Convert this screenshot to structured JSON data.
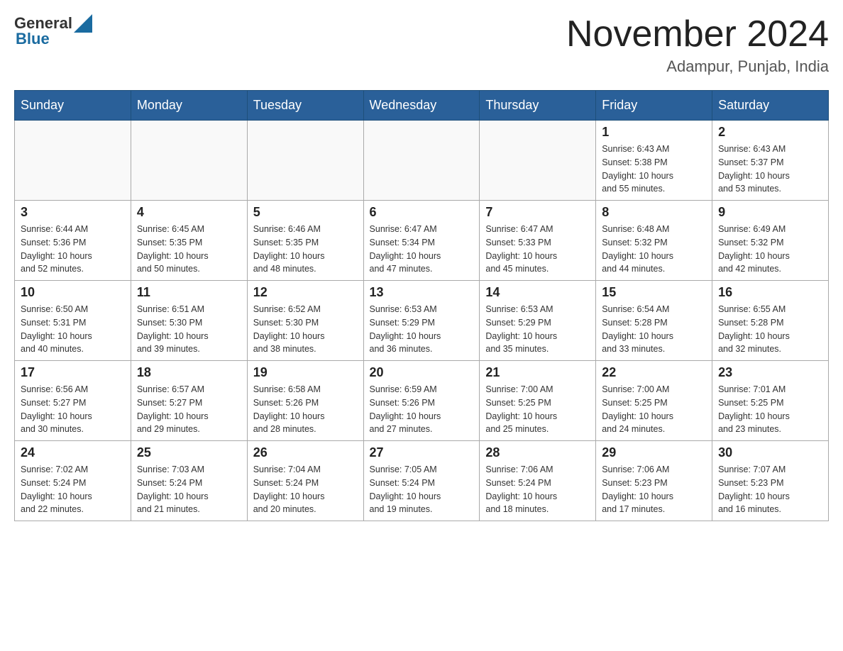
{
  "header": {
    "logo_general": "General",
    "logo_blue": "Blue",
    "title": "November 2024",
    "location": "Adampur, Punjab, India"
  },
  "days_of_week": [
    "Sunday",
    "Monday",
    "Tuesday",
    "Wednesday",
    "Thursday",
    "Friday",
    "Saturday"
  ],
  "weeks": [
    [
      {
        "day": "",
        "info": ""
      },
      {
        "day": "",
        "info": ""
      },
      {
        "day": "",
        "info": ""
      },
      {
        "day": "",
        "info": ""
      },
      {
        "day": "",
        "info": ""
      },
      {
        "day": "1",
        "info": "Sunrise: 6:43 AM\nSunset: 5:38 PM\nDaylight: 10 hours\nand 55 minutes."
      },
      {
        "day": "2",
        "info": "Sunrise: 6:43 AM\nSunset: 5:37 PM\nDaylight: 10 hours\nand 53 minutes."
      }
    ],
    [
      {
        "day": "3",
        "info": "Sunrise: 6:44 AM\nSunset: 5:36 PM\nDaylight: 10 hours\nand 52 minutes."
      },
      {
        "day": "4",
        "info": "Sunrise: 6:45 AM\nSunset: 5:35 PM\nDaylight: 10 hours\nand 50 minutes."
      },
      {
        "day": "5",
        "info": "Sunrise: 6:46 AM\nSunset: 5:35 PM\nDaylight: 10 hours\nand 48 minutes."
      },
      {
        "day": "6",
        "info": "Sunrise: 6:47 AM\nSunset: 5:34 PM\nDaylight: 10 hours\nand 47 minutes."
      },
      {
        "day": "7",
        "info": "Sunrise: 6:47 AM\nSunset: 5:33 PM\nDaylight: 10 hours\nand 45 minutes."
      },
      {
        "day": "8",
        "info": "Sunrise: 6:48 AM\nSunset: 5:32 PM\nDaylight: 10 hours\nand 44 minutes."
      },
      {
        "day": "9",
        "info": "Sunrise: 6:49 AM\nSunset: 5:32 PM\nDaylight: 10 hours\nand 42 minutes."
      }
    ],
    [
      {
        "day": "10",
        "info": "Sunrise: 6:50 AM\nSunset: 5:31 PM\nDaylight: 10 hours\nand 40 minutes."
      },
      {
        "day": "11",
        "info": "Sunrise: 6:51 AM\nSunset: 5:30 PM\nDaylight: 10 hours\nand 39 minutes."
      },
      {
        "day": "12",
        "info": "Sunrise: 6:52 AM\nSunset: 5:30 PM\nDaylight: 10 hours\nand 38 minutes."
      },
      {
        "day": "13",
        "info": "Sunrise: 6:53 AM\nSunset: 5:29 PM\nDaylight: 10 hours\nand 36 minutes."
      },
      {
        "day": "14",
        "info": "Sunrise: 6:53 AM\nSunset: 5:29 PM\nDaylight: 10 hours\nand 35 minutes."
      },
      {
        "day": "15",
        "info": "Sunrise: 6:54 AM\nSunset: 5:28 PM\nDaylight: 10 hours\nand 33 minutes."
      },
      {
        "day": "16",
        "info": "Sunrise: 6:55 AM\nSunset: 5:28 PM\nDaylight: 10 hours\nand 32 minutes."
      }
    ],
    [
      {
        "day": "17",
        "info": "Sunrise: 6:56 AM\nSunset: 5:27 PM\nDaylight: 10 hours\nand 30 minutes."
      },
      {
        "day": "18",
        "info": "Sunrise: 6:57 AM\nSunset: 5:27 PM\nDaylight: 10 hours\nand 29 minutes."
      },
      {
        "day": "19",
        "info": "Sunrise: 6:58 AM\nSunset: 5:26 PM\nDaylight: 10 hours\nand 28 minutes."
      },
      {
        "day": "20",
        "info": "Sunrise: 6:59 AM\nSunset: 5:26 PM\nDaylight: 10 hours\nand 27 minutes."
      },
      {
        "day": "21",
        "info": "Sunrise: 7:00 AM\nSunset: 5:25 PM\nDaylight: 10 hours\nand 25 minutes."
      },
      {
        "day": "22",
        "info": "Sunrise: 7:00 AM\nSunset: 5:25 PM\nDaylight: 10 hours\nand 24 minutes."
      },
      {
        "day": "23",
        "info": "Sunrise: 7:01 AM\nSunset: 5:25 PM\nDaylight: 10 hours\nand 23 minutes."
      }
    ],
    [
      {
        "day": "24",
        "info": "Sunrise: 7:02 AM\nSunset: 5:24 PM\nDaylight: 10 hours\nand 22 minutes."
      },
      {
        "day": "25",
        "info": "Sunrise: 7:03 AM\nSunset: 5:24 PM\nDaylight: 10 hours\nand 21 minutes."
      },
      {
        "day": "26",
        "info": "Sunrise: 7:04 AM\nSunset: 5:24 PM\nDaylight: 10 hours\nand 20 minutes."
      },
      {
        "day": "27",
        "info": "Sunrise: 7:05 AM\nSunset: 5:24 PM\nDaylight: 10 hours\nand 19 minutes."
      },
      {
        "day": "28",
        "info": "Sunrise: 7:06 AM\nSunset: 5:24 PM\nDaylight: 10 hours\nand 18 minutes."
      },
      {
        "day": "29",
        "info": "Sunrise: 7:06 AM\nSunset: 5:23 PM\nDaylight: 10 hours\nand 17 minutes."
      },
      {
        "day": "30",
        "info": "Sunrise: 7:07 AM\nSunset: 5:23 PM\nDaylight: 10 hours\nand 16 minutes."
      }
    ]
  ]
}
